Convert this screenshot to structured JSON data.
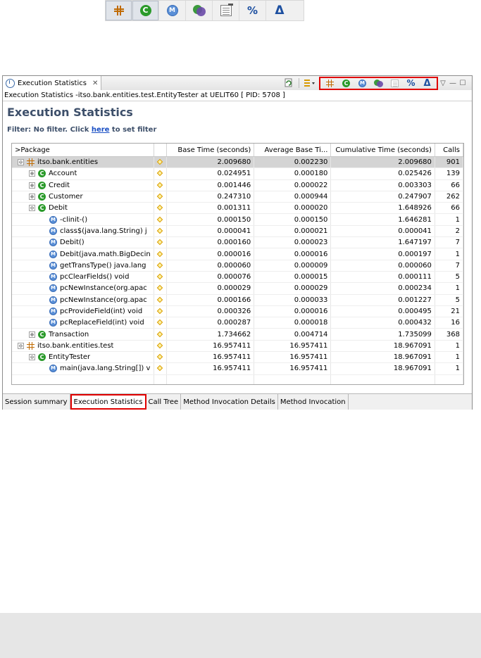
{
  "top_toolbar": {
    "buttons": [
      {
        "name": "package-level",
        "icon": "package-icon"
      },
      {
        "name": "class-level",
        "icon": "class-icon",
        "glyph": "C"
      },
      {
        "name": "method-level",
        "icon": "method-icon",
        "glyph": "M"
      },
      {
        "name": "instance-level",
        "icon": "instance-icon"
      },
      {
        "name": "open-source",
        "icon": "open-source-icon"
      },
      {
        "name": "percentage",
        "icon": "percent-icon",
        "glyph": "%"
      },
      {
        "name": "delta",
        "icon": "delta-icon",
        "glyph": "Δ"
      }
    ]
  },
  "view": {
    "tab_label": "Execution Statistics",
    "close_glyph": "✕",
    "path": "Execution Statistics -itso.bank.entities.test.EntityTester at UELIT60 [ PID: 5708 ]",
    "window_controls": {
      "menu": "▽",
      "minimize": "—",
      "maximize": "☐"
    }
  },
  "report": {
    "title": "Execution Statistics",
    "filter_prefix": "Filter: No filter. Click ",
    "filter_link": "here",
    "filter_suffix": " to set filter"
  },
  "table": {
    "columns": [
      ">Package",
      "",
      "Base Time (seconds)",
      "Average Base Ti...",
      "Cumulative Time (seconds)",
      "Calls"
    ],
    "rows": [
      {
        "level": 0,
        "expander": "⊖",
        "icon": "package-icon",
        "name": "itso.bank.entities",
        "base": "2.009680",
        "avg": "0.002230",
        "cum": "2.009680",
        "calls": "901",
        "selected": true
      },
      {
        "level": 1,
        "expander": "⊕",
        "icon": "class-icon",
        "name": "Account",
        "base": "0.024951",
        "avg": "0.000180",
        "cum": "0.025426",
        "calls": "139"
      },
      {
        "level": 1,
        "expander": "⊕",
        "icon": "class-icon",
        "name": "Credit",
        "base": "0.001446",
        "avg": "0.000022",
        "cum": "0.003303",
        "calls": "66"
      },
      {
        "level": 1,
        "expander": "⊕",
        "icon": "class-icon",
        "name": "Customer",
        "base": "0.247310",
        "avg": "0.000944",
        "cum": "0.247907",
        "calls": "262"
      },
      {
        "level": 1,
        "expander": "⊖",
        "icon": "class-icon",
        "name": "Debit",
        "base": "0.001311",
        "avg": "0.000020",
        "cum": "1.648926",
        "calls": "66"
      },
      {
        "level": 2,
        "expander": "",
        "icon": "method-icon",
        "name": "-clinit-()",
        "base": "0.000150",
        "avg": "0.000150",
        "cum": "1.646281",
        "calls": "1"
      },
      {
        "level": 2,
        "expander": "",
        "icon": "method-icon",
        "name": "class$(java.lang.String) j",
        "base": "0.000041",
        "avg": "0.000021",
        "cum": "0.000041",
        "calls": "2"
      },
      {
        "level": 2,
        "expander": "",
        "icon": "method-icon",
        "name": "Debit()",
        "base": "0.000160",
        "avg": "0.000023",
        "cum": "1.647197",
        "calls": "7"
      },
      {
        "level": 2,
        "expander": "",
        "icon": "method-icon",
        "name": "Debit(java.math.BigDecin",
        "base": "0.000016",
        "avg": "0.000016",
        "cum": "0.000197",
        "calls": "1"
      },
      {
        "level": 2,
        "expander": "",
        "icon": "method-icon",
        "name": "getTransType() java.lang",
        "base": "0.000060",
        "avg": "0.000009",
        "cum": "0.000060",
        "calls": "7"
      },
      {
        "level": 2,
        "expander": "",
        "icon": "method-icon",
        "name": "pcClearFields() void",
        "base": "0.000076",
        "avg": "0.000015",
        "cum": "0.000111",
        "calls": "5"
      },
      {
        "level": 2,
        "expander": "",
        "icon": "method-icon",
        "name": "pcNewInstance(org.apac",
        "base": "0.000029",
        "avg": "0.000029",
        "cum": "0.000234",
        "calls": "1"
      },
      {
        "level": 2,
        "expander": "",
        "icon": "method-icon",
        "name": "pcNewInstance(org.apac",
        "base": "0.000166",
        "avg": "0.000033",
        "cum": "0.001227",
        "calls": "5"
      },
      {
        "level": 2,
        "expander": "",
        "icon": "method-icon",
        "name": "pcProvideField(int) void",
        "base": "0.000326",
        "avg": "0.000016",
        "cum": "0.000495",
        "calls": "21"
      },
      {
        "level": 2,
        "expander": "",
        "icon": "method-icon",
        "name": "pcReplaceField(int) void",
        "base": "0.000287",
        "avg": "0.000018",
        "cum": "0.000432",
        "calls": "16"
      },
      {
        "level": 1,
        "expander": "⊕",
        "icon": "class-icon",
        "name": "Transaction",
        "base": "1.734662",
        "avg": "0.004714",
        "cum": "1.735099",
        "calls": "368"
      },
      {
        "level": 0,
        "expander": "⊖",
        "icon": "package-icon",
        "name": "itso.bank.entities.test",
        "base": "16.957411",
        "avg": "16.957411",
        "cum": "18.967091",
        "calls": "1"
      },
      {
        "level": 1,
        "expander": "⊖",
        "icon": "class-icon",
        "name": "EntityTester",
        "base": "16.957411",
        "avg": "16.957411",
        "cum": "18.967091",
        "calls": "1"
      },
      {
        "level": 2,
        "expander": "",
        "icon": "method-icon",
        "name": "main(java.lang.String[]) v",
        "base": "16.957411",
        "avg": "16.957411",
        "cum": "18.967091",
        "calls": "1"
      }
    ]
  },
  "bottom_tabs": [
    {
      "label": "Session summary",
      "active": false
    },
    {
      "label": "Execution Statistics",
      "active": true
    },
    {
      "label": "Call Tree",
      "active": false
    },
    {
      "label": "Method Invocation Details",
      "active": false
    },
    {
      "label": "Method Invocation",
      "active": false
    }
  ],
  "colors": {
    "highlight": "#e00000",
    "title": "#3d4f6a",
    "link": "#1a4fc4",
    "selected_row": "#d4d4d4"
  }
}
